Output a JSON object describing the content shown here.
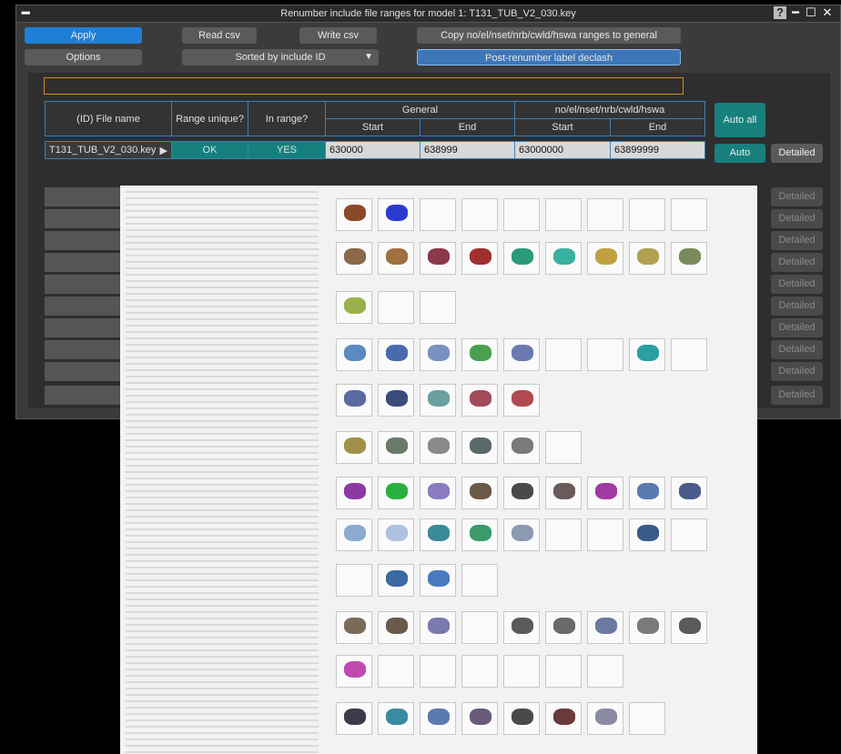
{
  "window": {
    "title": "Renumber include file ranges for model 1: T131_TUB_V2_030.key",
    "menu_dash": "━",
    "help": "?",
    "minimize": "━",
    "maximize": "☐",
    "close": "✕"
  },
  "toolbar": {
    "apply": "Apply",
    "read_csv": "Read csv",
    "write_csv": "Write csv",
    "copy_ranges": "Copy no/el/nset/nrb/cwld/hswa ranges to general",
    "options": "Options",
    "sort": "Sorted by include ID",
    "sort_arrow": "▼",
    "post_renumber": "Post-renumber label declash"
  },
  "table": {
    "headers": {
      "file_name": "(ID) File name",
      "range_unique": "Range unique?",
      "in_range": "In range?",
      "general": "General",
      "nodes": "no/el/nset/nrb/cwld/hswa",
      "start": "Start",
      "end": "End"
    },
    "row": {
      "file": "T131_TUB_V2_030.key",
      "file_arrow": "▶",
      "unique": "OK",
      "in_range": "YES",
      "gen_start": "630000",
      "gen_end": "638999",
      "no_start": "63000000",
      "no_end": "63899999"
    },
    "auto_all": "Auto all",
    "auto": "Auto",
    "detailed": "Detailed"
  },
  "faded_rows": [
    "Detailed",
    "Detailed",
    "Detailed",
    "Detailed",
    "Detailed",
    "Detailed",
    "Detailed",
    "Detailed",
    "Detailed",
    "Detailed"
  ]
}
